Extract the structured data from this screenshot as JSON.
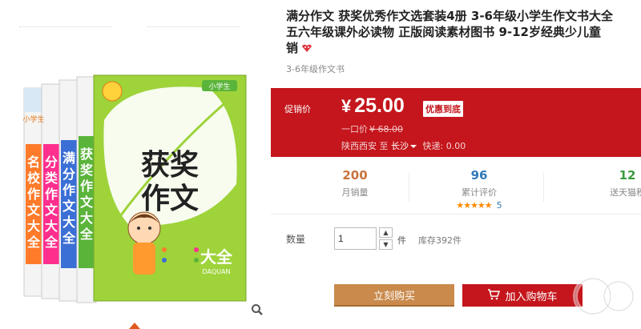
{
  "product": {
    "title_line1": "满分作文  获奖优秀作文选套装4册  3-6年级小学生作文书大全",
    "title_line2": "五六年级课外必读物  正版阅读素材图书  9-12岁经典少儿童",
    "title_line3": "销",
    "subtitle": "3-6年级作文书"
  },
  "books": {
    "titles": [
      "名校作文大全",
      "分类作文大全",
      "满分作文大全",
      "获奖作文大全"
    ],
    "badge": "小学生",
    "cover_title": "获奖作文",
    "cover_subtitle": "大全",
    "cover_pinyin": "DAQUAN"
  },
  "promo": {
    "label": "促销价",
    "currency": "¥",
    "price": "25.00",
    "tag": "优惠到底",
    "old_label": "一口价",
    "old_price": "¥ 68.00",
    "origin": "陕西西安",
    "to": "至",
    "dest": "长沙",
    "shipping": "快递: 0.00"
  },
  "stats": {
    "sales_num": "200",
    "sales_label": "月销量",
    "reviews_num": "96",
    "reviews_label": "累计评价",
    "stars": "★★★★★",
    "star_count": "5",
    "points_num": "12",
    "points_label": "送天猫积"
  },
  "quantity": {
    "label": "数量",
    "value": "1",
    "unit": "件",
    "stock": "库存392件"
  },
  "actions": {
    "buy_label": "立刻购买",
    "cart_label": "加入购物车"
  },
  "colors": {
    "promo_bg": "#c4161c",
    "buy_btn": "#c98a4c"
  },
  "icons": [
    "search-zoom-icon",
    "hot-badge-icon",
    "dropdown-caret-icon",
    "cart-icon",
    "stepper-up-icon",
    "stepper-down-icon"
  ]
}
